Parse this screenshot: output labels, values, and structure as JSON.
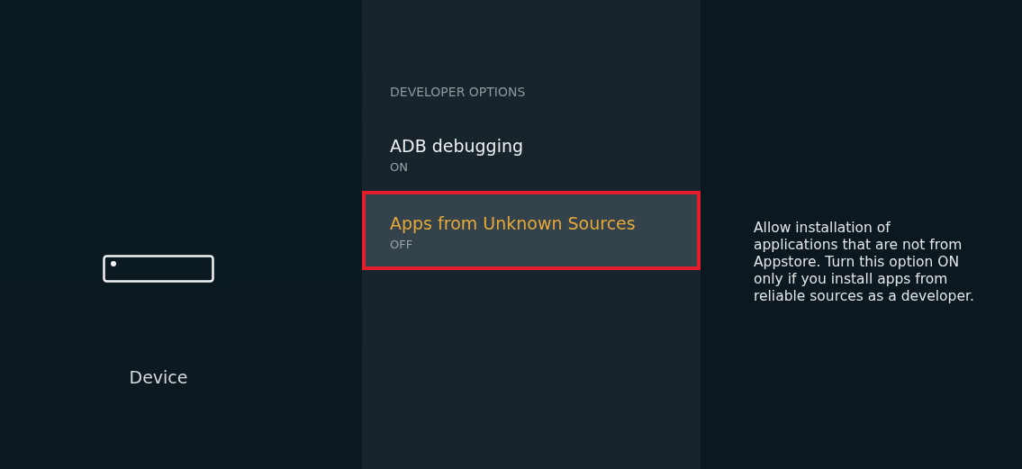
{
  "sidebar": {
    "label": "Device"
  },
  "menu": {
    "heading": "DEVELOPER OPTIONS",
    "options": [
      {
        "title": "ADB debugging",
        "status": "ON",
        "selected": false,
        "highlighted": false
      },
      {
        "title": "Apps from Unknown Sources",
        "status": "OFF",
        "selected": true,
        "highlighted": true
      }
    ]
  },
  "description": "Allow installation of applications that are not from Appstore. Turn this option ON only if you install apps from reliable sources as a developer."
}
